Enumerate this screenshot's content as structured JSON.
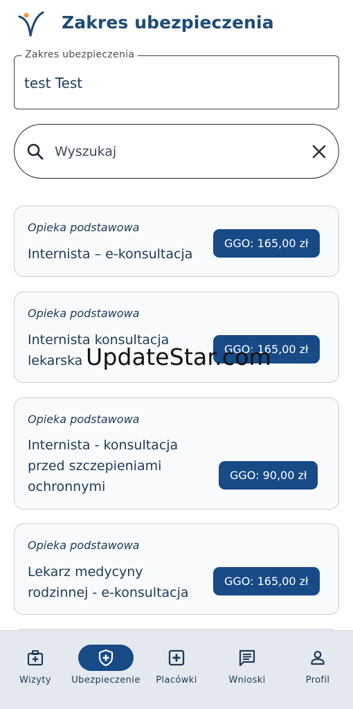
{
  "header": {
    "title": "Zakres ubezpieczenia",
    "logo_icon": "logo-icon"
  },
  "insurance_field": {
    "label": "Zakres ubezpieczenia",
    "value": "test Test"
  },
  "search": {
    "placeholder": "Wyszukaj",
    "value": ""
  },
  "cards": [
    {
      "category": "Opieka podstawowa",
      "name": [
        "Internista – e-konsultacja"
      ],
      "price": "GGO: 165,00 zł"
    },
    {
      "category": "Opieka podstawowa",
      "name": [
        "Internista konsultacja",
        "lekarska"
      ],
      "price": "GGO: 165,00 zł"
    },
    {
      "category": "Opieka podstawowa",
      "name": [
        "Internista - konsultacja",
        "przed szczepieniami",
        "ochronnymi"
      ],
      "price": "GGO: 90,00 zł"
    },
    {
      "category": "Opieka podstawowa",
      "name": [
        "Lekarz medycyny",
        "rodzinnej - e-konsultacja"
      ],
      "price": "GGO: 165,00 zł"
    }
  ],
  "watermark": "UpdateStar.com",
  "bottom_nav": {
    "items": [
      {
        "label": "Wizyty",
        "icon": "medical-bag-icon",
        "active": false
      },
      {
        "label": "Ubezpieczenie",
        "icon": "shield-plus-icon",
        "active": true
      },
      {
        "label": "Placówki",
        "icon": "hospital-box-icon",
        "active": false
      },
      {
        "label": "Wnioski",
        "icon": "message-text-icon",
        "active": false
      },
      {
        "label": "Profil",
        "icon": "person-icon",
        "active": false
      }
    ]
  },
  "colors": {
    "primary": "#174a86",
    "title": "#1f4b75",
    "text": "#1f3a56",
    "nav_bg": "#e3e9ef",
    "card_bg": "#f8fafb"
  }
}
